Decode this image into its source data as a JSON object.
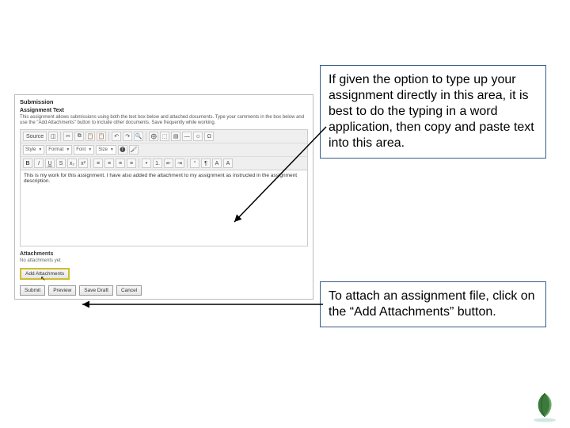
{
  "app": {
    "sectionTitle": "Submission",
    "assignmentHeading": "Assignment Text",
    "instructions": "This assignment allows submissions using both the text box below and attached documents. Type your comments in the box below and use the \"Add Attachments\" button to include other documents. Save frequently while working.",
    "toolbar": {
      "row1": {
        "source": "Source",
        "icons": [
          "◫",
          "✂",
          "⧉",
          "📋",
          "📋",
          "↶",
          "↷",
          "🔍",
          "⨁",
          "⬚",
          "▤",
          "—",
          "☺",
          "Ω"
        ]
      },
      "row2": {
        "style": "Style",
        "format": "Format",
        "font": "Font",
        "size": "Size",
        "icons": [
          "🅣",
          "🖌"
        ]
      },
      "row3": {
        "icons": [
          "B",
          "I",
          "U",
          "S",
          "x₂",
          "x²",
          "≡",
          "≡",
          "≡",
          "≡",
          "•",
          "1.",
          "⇤",
          "⇥",
          "“",
          "¶",
          "A",
          "A"
        ]
      }
    },
    "editorText": "This is my work for this assignment. I have also added the attachment to my assignment as instructed in the assignment description.",
    "attachments": {
      "heading": "Attachments",
      "sub": "No attachments yet",
      "addBtn": "Add Attachments"
    },
    "buttons": {
      "submit": "Submit",
      "preview": "Preview",
      "saveDraft": "Save Draft",
      "cancel": "Cancel"
    }
  },
  "callouts": {
    "c1": "If given the option to type up your assignment directly in this area, it is best to do the typing in a word application, then copy and paste text into this area.",
    "c2": "To attach an assignment file, click on the “Add Attachments” button."
  },
  "icons": {
    "cursor": "↖"
  }
}
